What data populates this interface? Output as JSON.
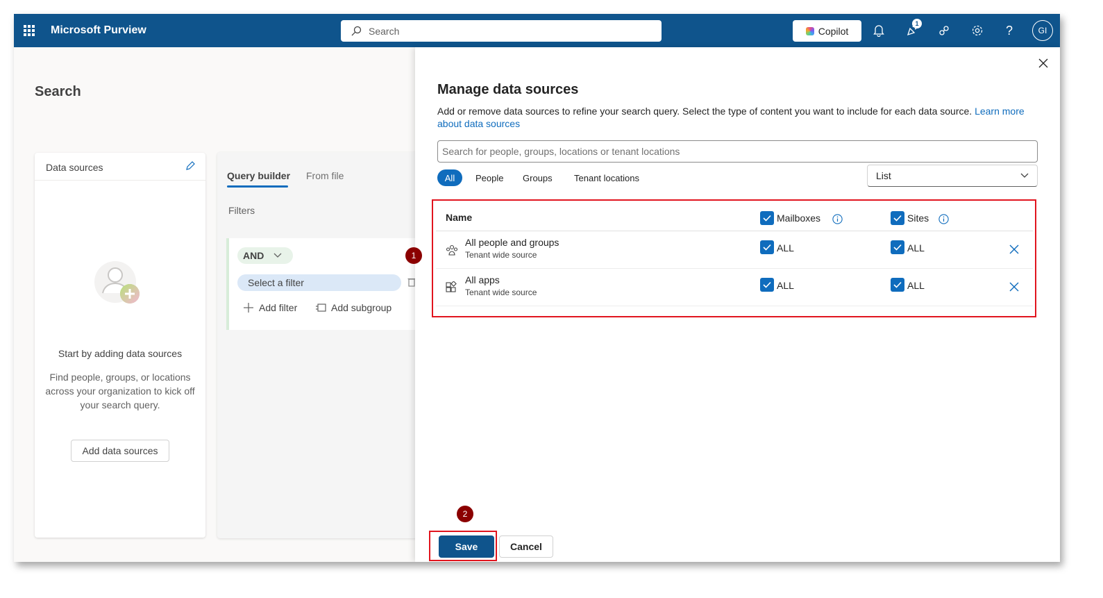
{
  "topbar": {
    "app_name": "Microsoft Purview",
    "search_placeholder": "Search",
    "copilot_label": "Copilot",
    "notification_count": "1",
    "avatar_initials": "GI",
    "bar_color": "#0f548c"
  },
  "page": {
    "title": "Search"
  },
  "data_sources_card": {
    "header": "Data sources",
    "empty_title": "Start by adding data sources",
    "empty_desc": "Find people, groups, or locations across your organization to kick off your search query.",
    "add_button": "Add data sources"
  },
  "query_builder": {
    "tabs": [
      {
        "label": "Query builder",
        "active": true
      },
      {
        "label": "From file",
        "active": false
      }
    ],
    "filters_label": "Filters",
    "operator": "AND",
    "filter_placeholder": "Select a filter",
    "add_filter": "Add filter",
    "add_subgroup": "Add subgroup"
  },
  "annotations": {
    "marker_1": "1",
    "marker_2": "2",
    "highlight_color": "#e1141e"
  },
  "panel": {
    "title": "Manage data sources",
    "description": "Add or remove data sources to refine your search query. Select the type of content you want to include for each data source.",
    "learn_more": "Learn more about data sources",
    "search_placeholder": "Search for people, groups, locations or tenant locations",
    "pivots": [
      "All",
      "People",
      "Groups",
      "Tenant locations"
    ],
    "view_select": "List",
    "table": {
      "name_header": "Name",
      "mailboxes_header": "Mailboxes",
      "sites_header": "Sites",
      "rows": [
        {
          "name": "All people and groups",
          "sub": "Tenant wide source",
          "mailboxes": "ALL",
          "sites": "ALL",
          "icon": "people-group-icon"
        },
        {
          "name": "All apps",
          "sub": "Tenant wide source",
          "mailboxes": "ALL",
          "sites": "ALL",
          "icon": "apps-icon"
        }
      ]
    },
    "save_label": "Save",
    "cancel_label": "Cancel",
    "accent_color": "#0f6cbd"
  }
}
